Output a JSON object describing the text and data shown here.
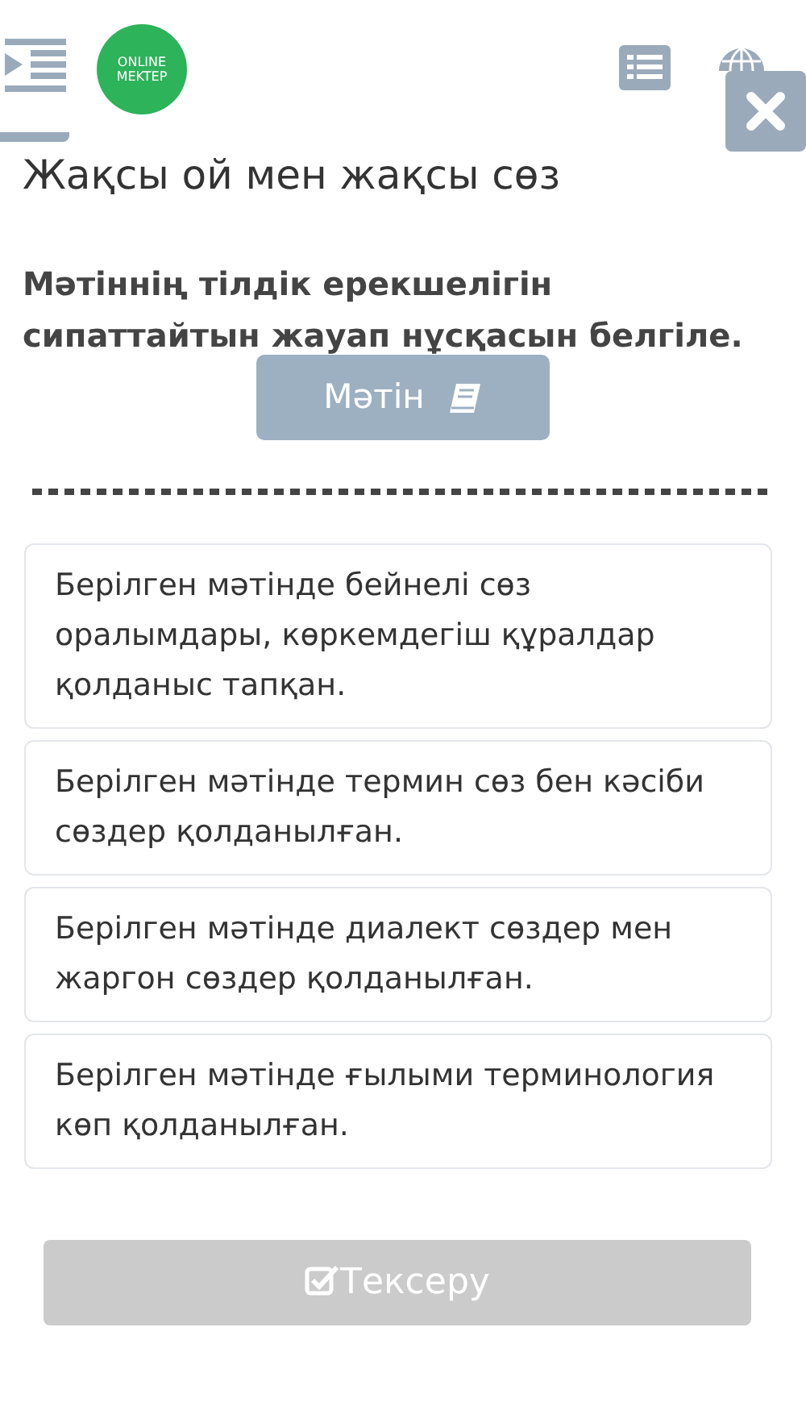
{
  "header": {
    "logo_lines": [
      "ONLINE",
      "MEKTEP"
    ]
  },
  "title": "Жақсы ой мен жақсы сөз",
  "question": "Мәтіннің тілдік ерекшелігін сипаттайтын жауап нұсқасын белгіле.",
  "text_button": "Мәтін",
  "options": [
    {
      "label": "Берілген мәтінде бейнелі сөз оралымдары, көркемдегіш құралдар қолданыс тапқан.",
      "selected": false
    },
    {
      "label": "Берілген мәтінде термин сөз бен кәсіби сөздер қолданылған.",
      "selected": false
    },
    {
      "label": "Берілген мәтінде диалект сөздер мен жаргон сөздер қолданылған.",
      "selected": false
    },
    {
      "label": "Берілген мәтінде ғылыми терминология көп қолданылған.",
      "selected": false
    }
  ],
  "check_button": {
    "label": "Тексеру",
    "disabled": true
  }
}
